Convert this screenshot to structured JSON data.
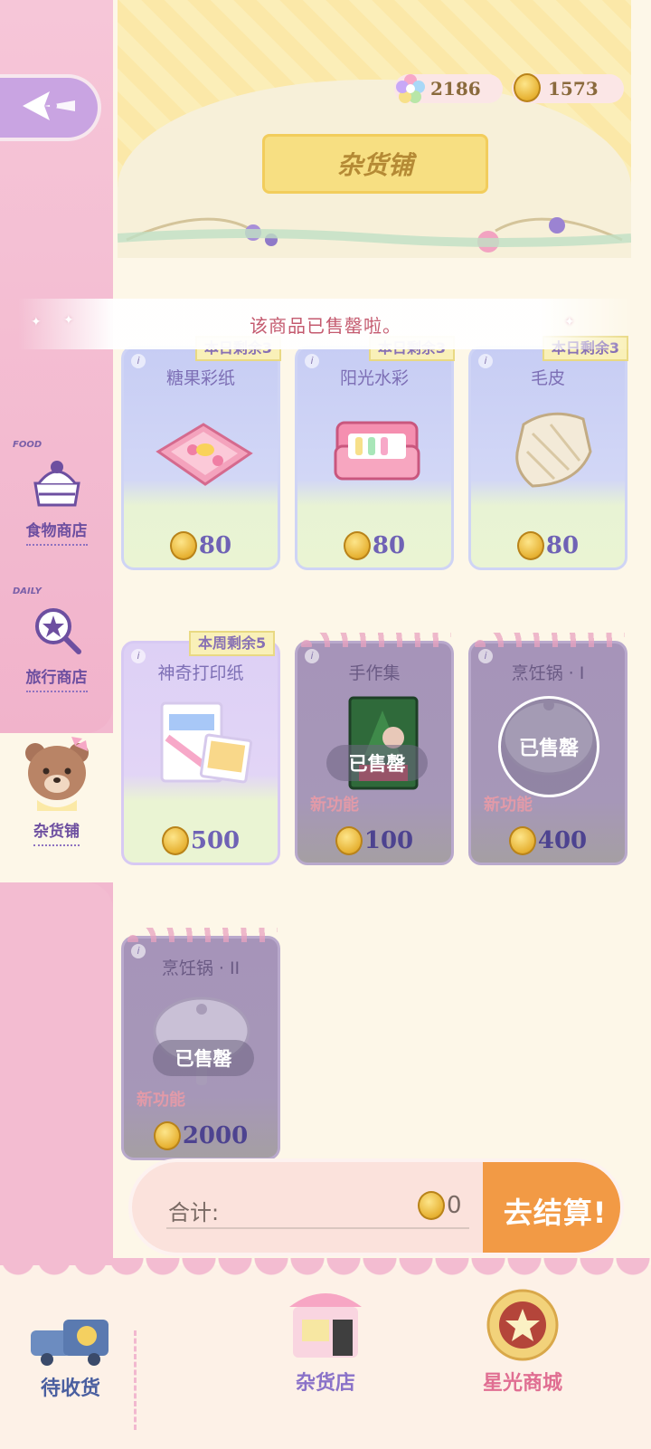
{
  "currency": {
    "gems": "2186",
    "coins": "1573"
  },
  "header": {
    "title": "杂货铺"
  },
  "toast": {
    "message": "该商品已售罄啦。"
  },
  "sidebar": {
    "items": [
      {
        "tag": "FOOD",
        "label": "食物商店"
      },
      {
        "tag": "DAILY",
        "label": "旅行商店"
      },
      {
        "label": "杂货铺"
      }
    ]
  },
  "products": [
    {
      "name": "糖果彩纸",
      "price": "80",
      "limit": "本日剩余3"
    },
    {
      "name": "阳光水彩",
      "price": "80",
      "limit": "本日剩余3"
    },
    {
      "name": "毛皮",
      "price": "80",
      "limit": "本日剩余3"
    },
    {
      "name": "神奇打印纸",
      "price": "500",
      "limit": "本周剩余5"
    },
    {
      "name": "手作集",
      "price": "100",
      "status": "已售罄",
      "badge": "新功能"
    },
    {
      "name": "烹饪锅 · I",
      "price": "400",
      "status": "已售罄",
      "badge": "新功能"
    },
    {
      "name": "烹饪锅 · II",
      "price": "2000",
      "status": "已售罄",
      "badge": "新功能"
    }
  ],
  "total": {
    "label": "合计:",
    "amount": "0",
    "checkout_label": "去结算!"
  },
  "bottom_nav": {
    "pending": "待收货",
    "grocery": "杂货店",
    "starlight": "星光商城"
  },
  "colors": {
    "accent_pink": "#f2b8cf",
    "checkout_orange": "#f29a45",
    "text_purple": "#6d4fa0"
  }
}
